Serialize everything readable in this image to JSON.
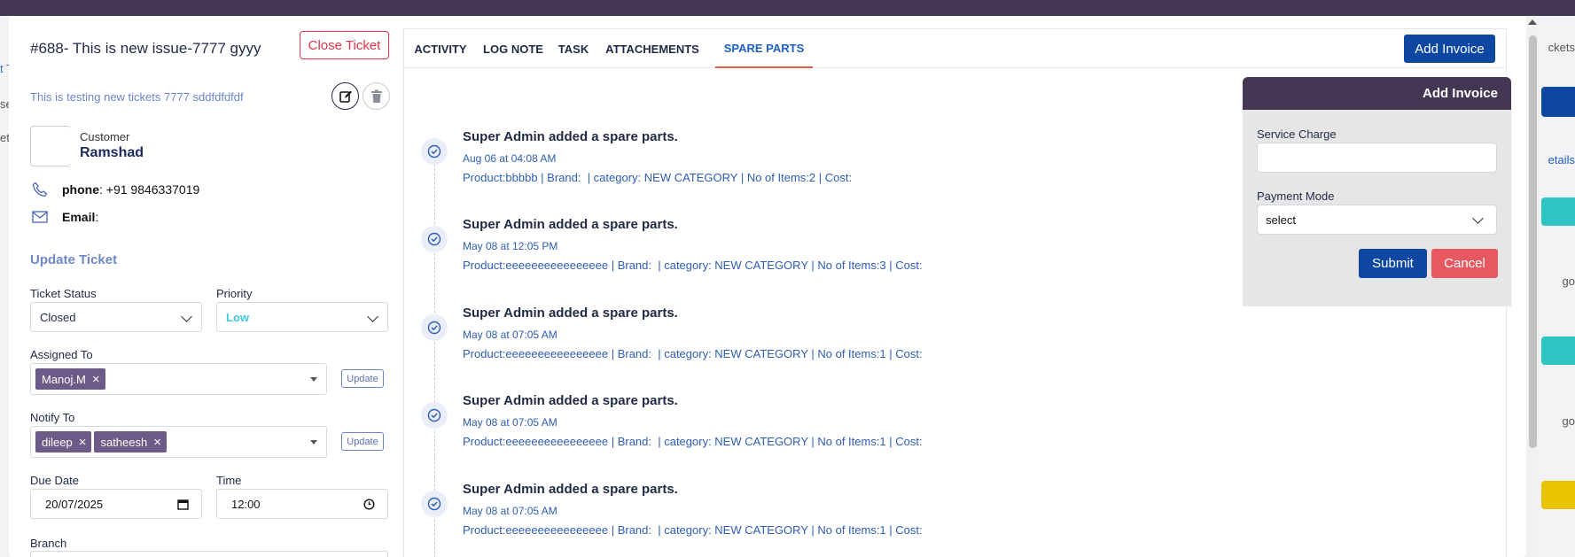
{
  "background": {
    "left_fragments": [
      "t T",
      "se",
      "et"
    ],
    "right_fragments": [
      "ckets",
      "etails",
      "go",
      "go"
    ]
  },
  "ticket": {
    "title": "#688- This is new issue-7777 gyyy",
    "close_label": "Close Ticket",
    "description": "This is testing new tickets 7777 sddfdfdfdf"
  },
  "customer": {
    "label": "Customer",
    "name": "Ramshad",
    "phone_label": "phone",
    "phone_value": " : +91 9846337019",
    "email_label": "Email",
    "email_value": " :"
  },
  "update_ticket": {
    "title": "Update Ticket",
    "status_label": "Ticket Status",
    "status_value": "Closed",
    "priority_label": "Priority",
    "priority_value": "Low",
    "priority_color": "#3ec7e0",
    "assigned_label": "Assigned To",
    "assigned": [
      "Manoj.M"
    ],
    "notify_label": "Notify To",
    "notify": [
      "dileep",
      "satheesh"
    ],
    "update_label": "Update",
    "due_label": "Due Date",
    "due_value": "20/07/2025",
    "time_label": "Time",
    "time_value": "12:00",
    "branch_label": "Branch"
  },
  "tabs": [
    "ACTIVITY",
    "LOG NOTE",
    "TASK",
    "ATTACHEMENTS",
    "SPARE PARTS"
  ],
  "active_tab": "SPARE PARTS",
  "add_invoice_button": "Add Invoice",
  "timeline": [
    {
      "head": "Super Admin added a spare parts.",
      "time": "Aug 06 at 04:08 AM",
      "detail": "Product:bbbbb | Brand:  | category: NEW CATEGORY | No of Items:2 | Cost:"
    },
    {
      "head": "Super Admin added a spare parts.",
      "time": "May 08 at 12:05 PM",
      "detail": "Product:eeeeeeeeeeeeeeee | Brand:  | category: NEW CATEGORY | No of Items:3 | Cost:"
    },
    {
      "head": "Super Admin added a spare parts.",
      "time": "May 08 at 07:05 AM",
      "detail": "Product:eeeeeeeeeeeeeeee | Brand:  | category: NEW CATEGORY | No of Items:1 | Cost:"
    },
    {
      "head": "Super Admin added a spare parts.",
      "time": "May 08 at 07:05 AM",
      "detail": "Product:eeeeeeeeeeeeeeee | Brand:  | category: NEW CATEGORY | No of Items:1 | Cost:"
    },
    {
      "head": "Super Admin added a spare parts.",
      "time": "May 08 at 07:05 AM",
      "detail": "Product:eeeeeeeeeeeeeeee | Brand:  | category: NEW CATEGORY | No of Items:1 | Cost:"
    }
  ],
  "invoice_form": {
    "title": "Add Invoice",
    "service_charge_label": "Service Charge",
    "service_charge_value": "",
    "payment_mode_label": "Payment Mode",
    "payment_mode_value": "select",
    "submit_label": "Submit",
    "cancel_label": "Cancel"
  },
  "colors": {
    "header_purple": "#433754",
    "primary_blue": "#0d47a1",
    "danger_red": "#dc3545",
    "chip_purple": "#6e5a86"
  }
}
